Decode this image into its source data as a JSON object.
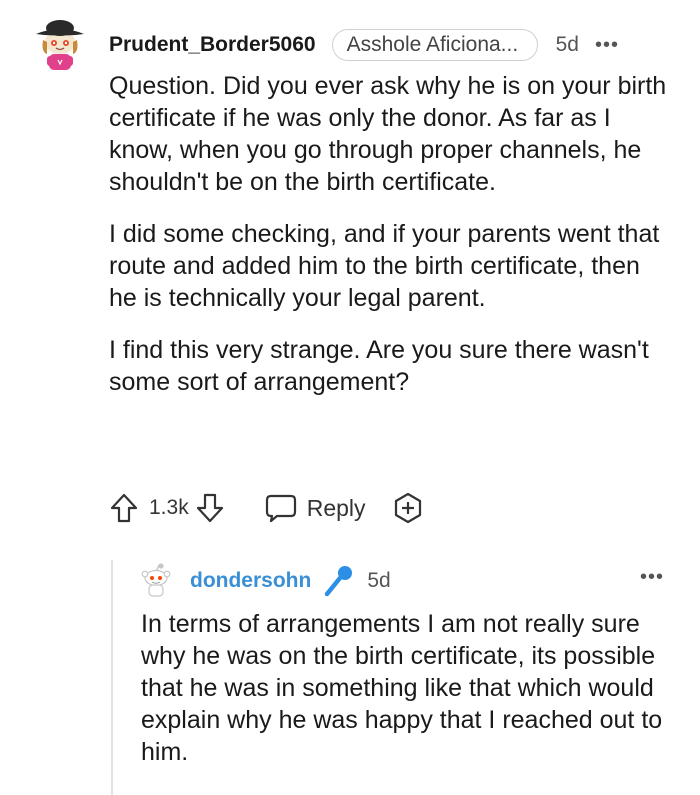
{
  "comment": {
    "username": "Prudent_Border5060",
    "flair": "Asshole Aficiona...",
    "timestamp": "5d",
    "more_label": "•••",
    "paragraphs": [
      "Question. Did you ever ask why he is on your birth certificate if he was only the donor. As far as I know, when you go through proper channels, he shouldn't be on the birth certificate.",
      "I did some checking, and if your parents went that route and added him to the birth certificate, then he is technically your legal parent.",
      "I find this very strange. Are you sure there wasn't some sort of arrangement?"
    ],
    "vote_count": "1.3k",
    "reply_label": "Reply"
  },
  "reply": {
    "username": "dondersohn",
    "timestamp": "5d",
    "more_label": "•••",
    "text": "In terms of arrangements I am not really sure why he was on the birth certificate, its possible that he was in something like that which would explain why he was happy that I reached out to him."
  },
  "colors": {
    "op_username": "#3a8fd6",
    "text": "#1a1a1b",
    "mic": "#2b8fe6"
  },
  "icons": {
    "upvote": "arrow-up-icon",
    "downvote": "arrow-down-icon",
    "reply": "chat-bubble-icon",
    "award": "award-plus-icon",
    "mic": "microphone-icon"
  }
}
